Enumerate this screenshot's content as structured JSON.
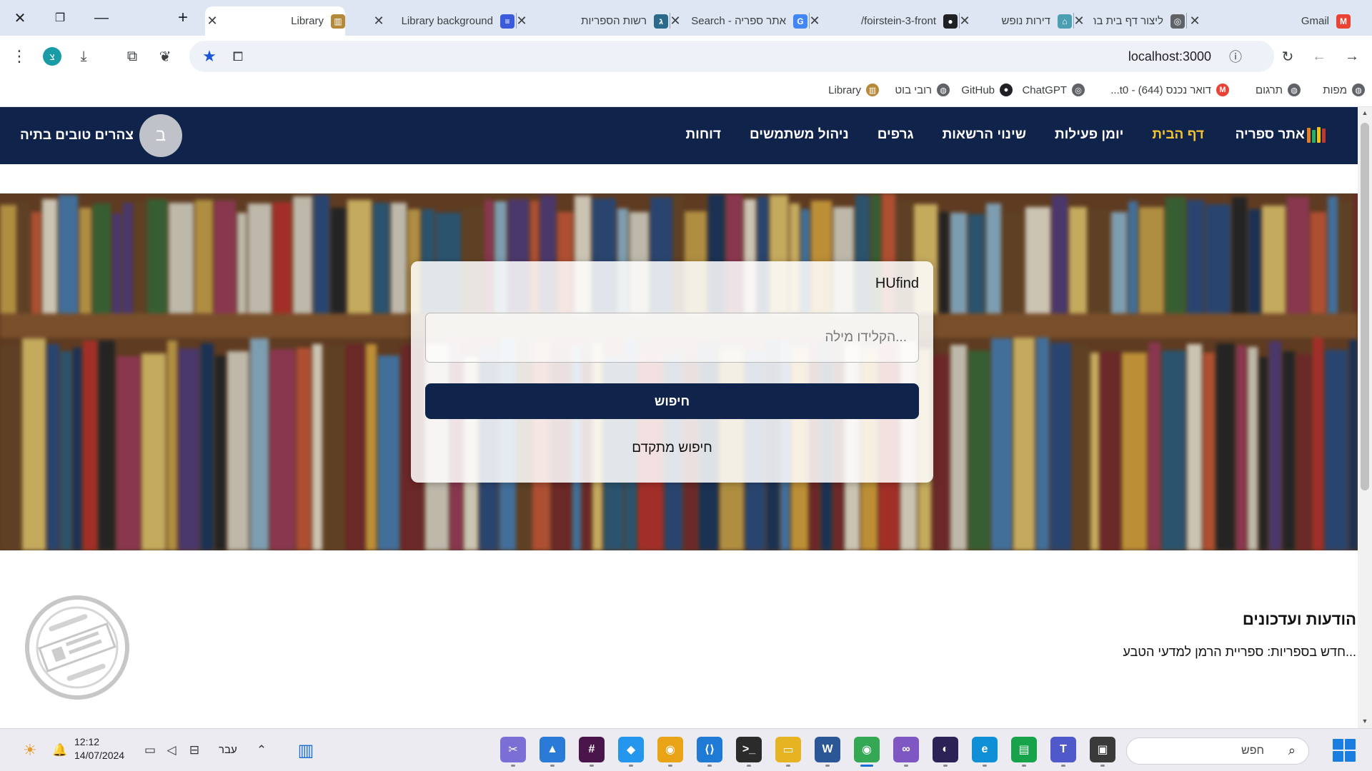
{
  "browser": {
    "tabs": [
      {
        "title": "Gmail",
        "icon": "gmail-icon",
        "color": "#ea4335",
        "glyph": "M",
        "active": false
      },
      {
        "title": "ליצור דף בית בריא",
        "icon": "chatgpt-icon",
        "color": "#5f6368",
        "glyph": "◎",
        "active": false
      },
      {
        "title": "דירות נופש",
        "icon": "site-icon",
        "color": "#4b9fb0",
        "glyph": "⌂",
        "active": false
      },
      {
        "title": "foirstein-3-front/",
        "icon": "github-icon",
        "color": "#202124",
        "glyph": "●",
        "active": false
      },
      {
        "title": "אתר ספריה - Search",
        "icon": "google-icon",
        "color": "#4285f4",
        "glyph": "G",
        "active": false
      },
      {
        "title": "רשות הספריות",
        "icon": "library-authority-icon",
        "color": "#2b6a8a",
        "glyph": "ג",
        "active": false
      },
      {
        "title": "Library background",
        "icon": "forms-icon",
        "color": "#3b5bdb",
        "glyph": "≡",
        "active": false
      },
      {
        "title": "Library",
        "icon": "library-icon",
        "color": "#b5893a",
        "glyph": "▥",
        "active": true
      }
    ],
    "url": "localhost:3000",
    "profile_initial": "צ",
    "bookmarks": [
      {
        "label": "מפות",
        "icon": "globe-icon",
        "color": "#5f6368",
        "glyph": "◍"
      },
      {
        "label": "תרגום",
        "icon": "globe-icon",
        "color": "#5f6368",
        "glyph": "◍"
      },
      {
        "label": "דואר נכנס (644) - t0...",
        "icon": "gmail-icon",
        "color": "#ea4335",
        "glyph": "M"
      },
      {
        "label": "ChatGPT",
        "icon": "chatgpt-icon",
        "color": "#5f6368",
        "glyph": "◎"
      },
      {
        "label": "GitHub",
        "icon": "github-icon",
        "color": "#202124",
        "glyph": "●"
      },
      {
        "label": "רובי בוט",
        "icon": "globe-icon",
        "color": "#5f6368",
        "glyph": "◍"
      },
      {
        "label": "Library",
        "icon": "library-icon",
        "color": "#b5893a",
        "glyph": "▥"
      }
    ]
  },
  "site": {
    "brand": "אתר ספריה",
    "nav": [
      {
        "label": "דף הבית",
        "active": true
      },
      {
        "label": "יומן פעילות",
        "active": false
      },
      {
        "label": "שינוי הרשאות",
        "active": false
      },
      {
        "label": "גרפים",
        "active": false
      },
      {
        "label": "ניהול משתמשים",
        "active": false
      },
      {
        "label": "דוחות",
        "active": false
      }
    ],
    "user": {
      "initial": "ב",
      "greeting": "צהרים טובים בתיה"
    },
    "search": {
      "title": "HUfind",
      "placeholder": "...הקלידו מילה",
      "button": "חיפוש",
      "advanced": "חיפוש מתקדם"
    },
    "announcements": {
      "title": "הודעות ועדכונים",
      "items": [
        "...חדש בספריות: ספריית הרמן למדעי הטבע"
      ]
    },
    "colors": {
      "navbar": "#10234a",
      "nav_active": "#f4c430",
      "button": "#10234a"
    }
  },
  "taskbar": {
    "time": "12:12",
    "date": "14/07/2024",
    "language": "עבר",
    "search_label": "חפש",
    "apps": [
      {
        "name": "snipping-tool-icon",
        "color": "#7b6fd6",
        "glyph": "✂"
      },
      {
        "name": "photos-icon",
        "color": "#2a7bd8",
        "glyph": "▲"
      },
      {
        "name": "slack-icon",
        "color": "#4a154b",
        "glyph": "#"
      },
      {
        "name": "docker-icon",
        "color": "#2496ed",
        "glyph": "◆"
      },
      {
        "name": "chrome-canary-icon",
        "color": "#e8a317",
        "glyph": "◉"
      },
      {
        "name": "vscode-icon",
        "color": "#1f7ad6",
        "glyph": "⟨⟩"
      },
      {
        "name": "terminal-icon",
        "color": "#2b2b2b",
        "glyph": ">_"
      },
      {
        "name": "file-explorer-icon",
        "color": "#e6b422",
        "glyph": "▭"
      },
      {
        "name": "word-icon",
        "color": "#2b5797",
        "glyph": "W"
      },
      {
        "name": "chrome-icon",
        "color": "#34a853",
        "glyph": "◉"
      },
      {
        "name": "visual-studio-icon",
        "color": "#7e57c2",
        "glyph": "∞"
      },
      {
        "name": "eclipse-icon",
        "color": "#2c2255",
        "glyph": "◐"
      },
      {
        "name": "edge-icon",
        "color": "#0f8fd6",
        "glyph": "e"
      },
      {
        "name": "chat-icon",
        "color": "#16a34a",
        "glyph": "▤"
      },
      {
        "name": "teams-icon",
        "color": "#5059c9",
        "glyph": "T"
      },
      {
        "name": "terminal-dark-icon",
        "color": "#3a3a3a",
        "glyph": "▣"
      }
    ]
  }
}
